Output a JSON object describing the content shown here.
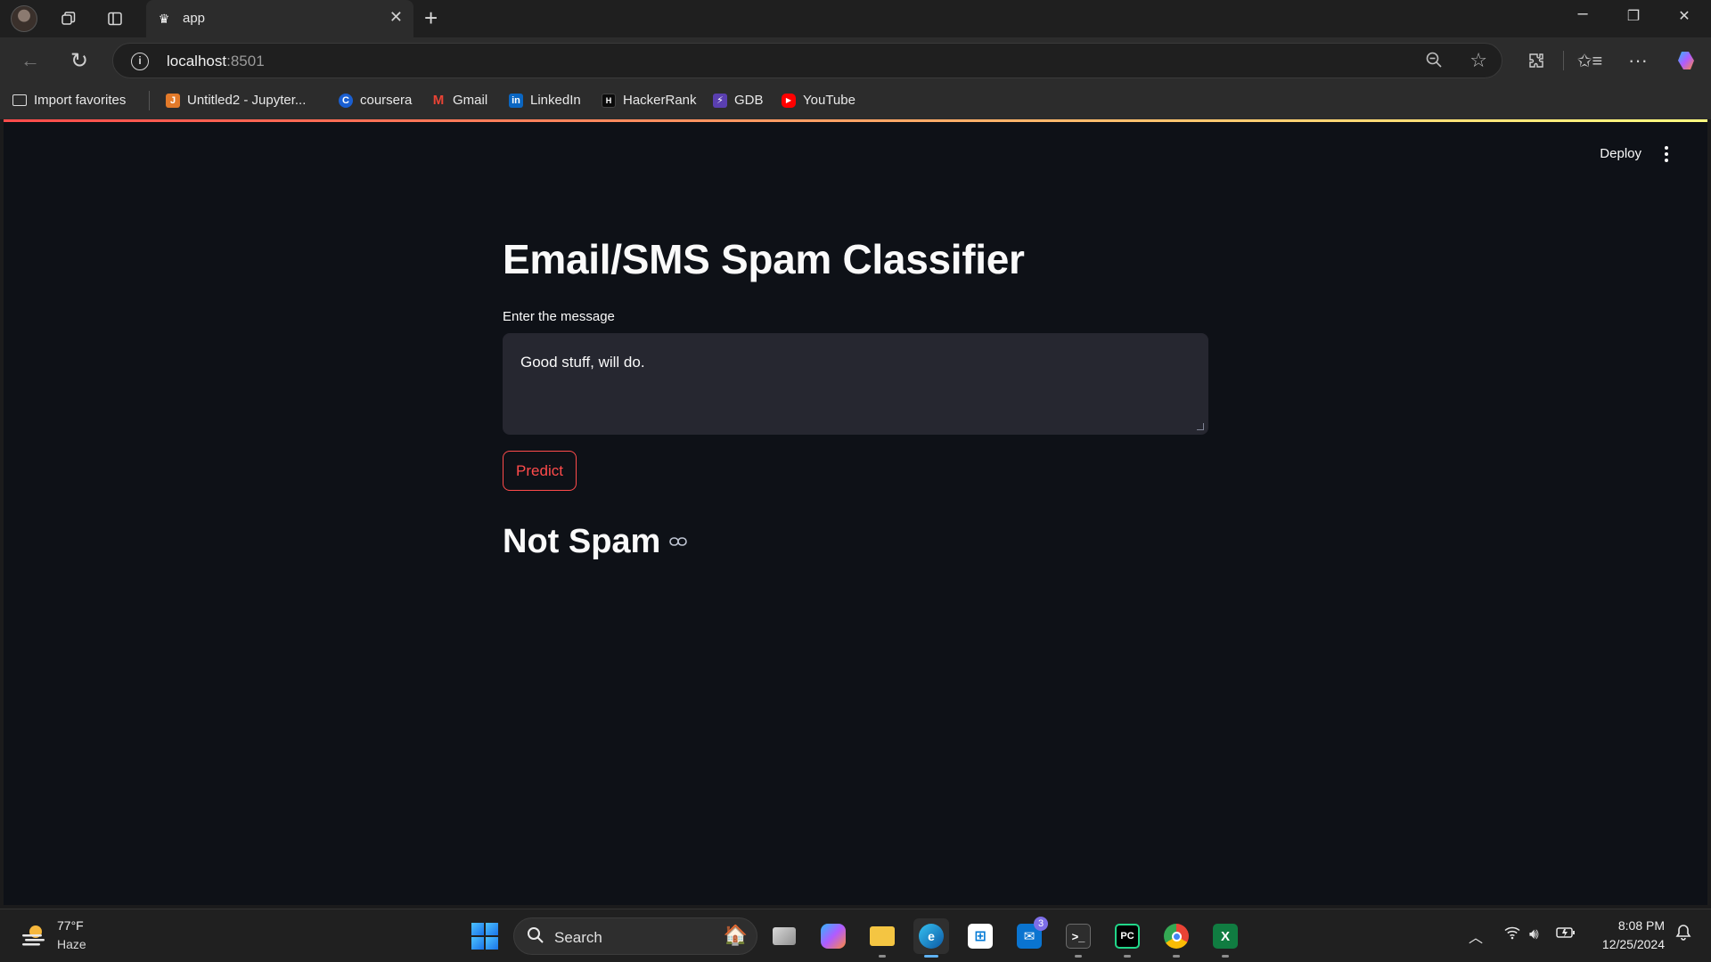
{
  "browser": {
    "tab_title": "app",
    "url_host": "localhost",
    "url_port": ":8501",
    "favorites": [
      {
        "label": "Import favorites",
        "icon": "folder-import-icon"
      },
      {
        "label": "Untitled2 - Jupyter...",
        "icon": "jupyter-icon"
      },
      {
        "label": "coursera",
        "icon": "coursera-icon"
      },
      {
        "label": "Gmail",
        "icon": "gmail-icon"
      },
      {
        "label": "LinkedIn",
        "icon": "linkedin-icon"
      },
      {
        "label": "HackerRank",
        "icon": "hackerrank-icon"
      },
      {
        "label": "GDB",
        "icon": "gdb-icon"
      },
      {
        "label": "YouTube",
        "icon": "youtube-icon"
      }
    ]
  },
  "app": {
    "deploy_label": "Deploy",
    "title": "Email/SMS Spam Classifier",
    "input_label": "Enter the message",
    "input_value": "Good stuff, will do.",
    "predict_label": "Predict",
    "result": "Not Spam",
    "colors": {
      "background": "#0e1117",
      "accent": "#ff4b4b",
      "input_bg": "#262730"
    }
  },
  "taskbar": {
    "weather_temp": "77°F",
    "weather_desc": "Haze",
    "search_placeholder": "Search",
    "mail_badge": "3",
    "time": "8:08 PM",
    "date": "12/25/2024"
  }
}
